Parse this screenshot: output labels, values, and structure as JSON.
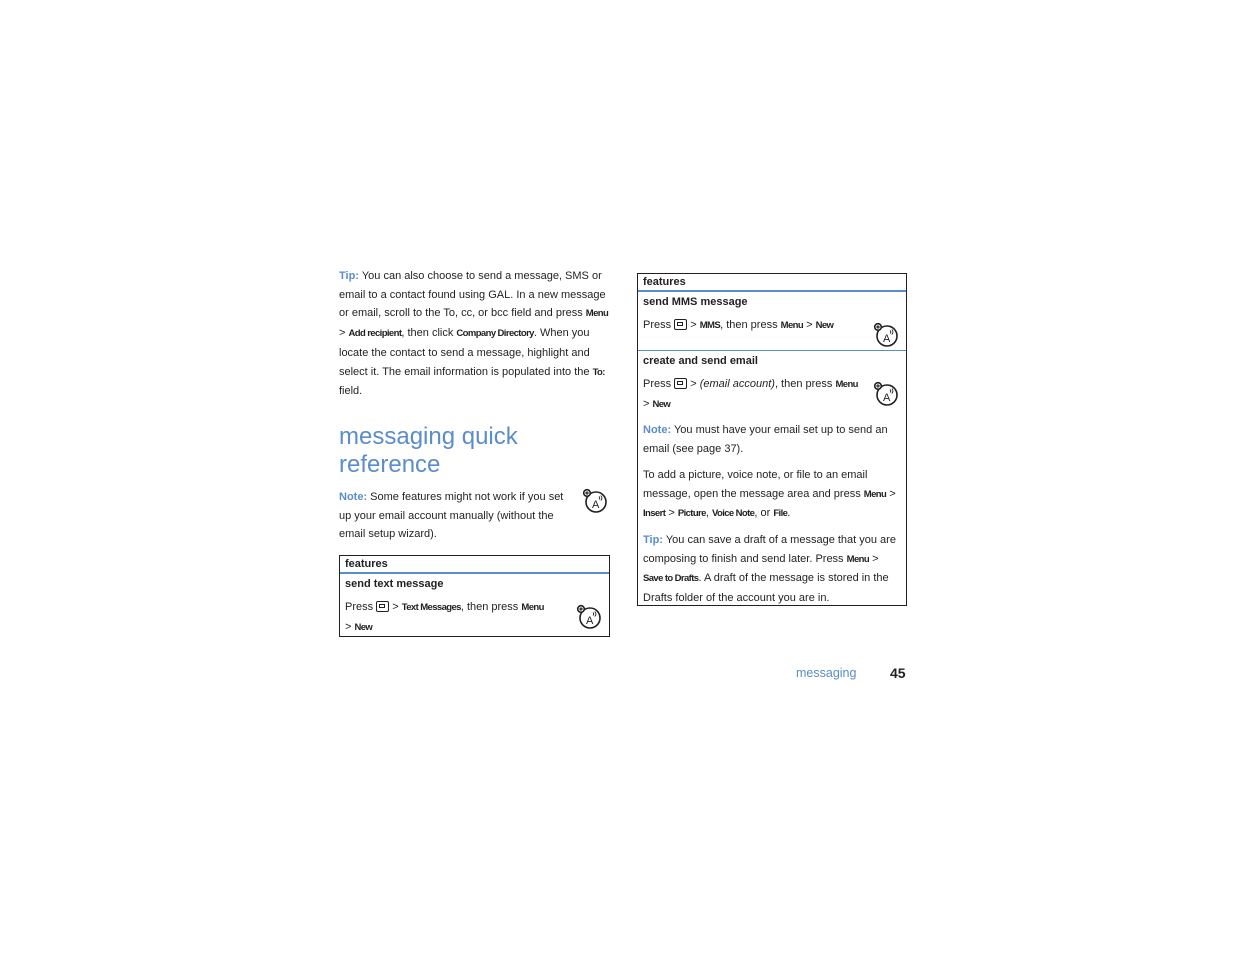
{
  "left_column": {
    "tip": {
      "label": "Tip:",
      "t1": " You can also choose to send a message, SMS or email to a contact found using GAL. In a new message or email, scroll to the To, cc, or bcc field and press ",
      "k1": "Menu",
      "s1": " > ",
      "k2": "Add recipient",
      "t2": ", then click ",
      "k3": "Company Directory",
      "t3": ". When you locate the contact to send a message, highlight and select it. The email information is populated into the ",
      "k4": "To:",
      "t4": " field."
    },
    "title": "messaging quick reference",
    "note": {
      "label": "Note:",
      "text": " Some features might not work if you set up your email account manually (without the email setup wizard)."
    },
    "table": {
      "header": "features",
      "rows": [
        {
          "title": "send text message",
          "press": "Press",
          "sep1": " > ",
          "k1": "Text Messages",
          "t1": ", then press ",
          "k2": "Menu",
          "sep2": " > ",
          "k3": "New"
        }
      ]
    }
  },
  "right_column": {
    "table": {
      "header": "features",
      "mms": {
        "title": "send MMS message",
        "press": "Press",
        "sep1": " > ",
        "k1": "MMS",
        "t1": ", then press ",
        "k2": "Menu",
        "sep2": " > ",
        "k3": "New"
      },
      "email": {
        "title": "create and send email",
        "press": "Press",
        "sep1": " > ",
        "italic": "(email account)",
        "t1": ", then press ",
        "k2": "Menu",
        "sep2": " > ",
        "k3": "New",
        "note_label": "Note:",
        "note_text": " You must have your email set up to send an email (see page 37).",
        "add_t1": "To add a picture, voice note, or file to an email message, open the message area and press ",
        "add_k1": "Menu",
        "add_s1": " > ",
        "add_k2": "Insert",
        "add_s2": " > ",
        "add_k3": "Picture",
        "add_c1": ", ",
        "add_k4": "Voice Note",
        "add_c2": ", or ",
        "add_k5": "File",
        "add_end": ".",
        "tip_label": "Tip:",
        "tip_t1": " You can save a draft of a message that you are composing to finish and send later. Press ",
        "tip_k1": "Menu",
        "tip_s1": " > ",
        "tip_k2": "Save to Drafts",
        "tip_t2": ". A draft of the message is stored in the Drafts folder of the account you are in."
      }
    }
  },
  "footer": {
    "section": "messaging",
    "page_number": "45"
  },
  "icons": {
    "message_key": "message-key-icon",
    "network_feature": "network-dependent-feature-icon"
  }
}
